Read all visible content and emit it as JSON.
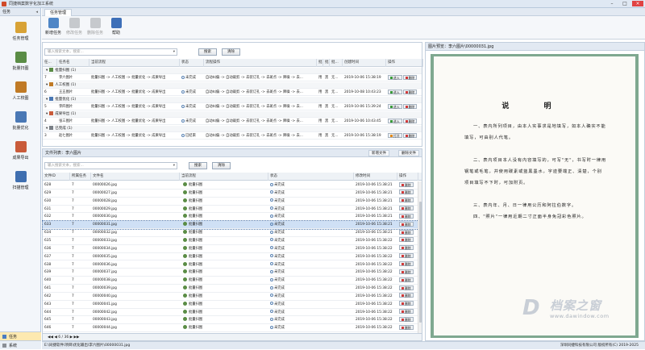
{
  "app": {
    "title": "同捷档案数字化加工系统"
  },
  "left": {
    "header": "任务",
    "items": [
      {
        "label": "任务管理",
        "color": "#d8a235"
      },
      {
        "label": "批量扫图",
        "color": "#5a8c45"
      },
      {
        "label": "人工校图",
        "color": "#c07a25"
      },
      {
        "label": "批量优化",
        "color": "#4a78b5"
      },
      {
        "label": "成果导出",
        "color": "#c95b3a"
      },
      {
        "label": "扫描管理",
        "color": "#3f6fb0"
      }
    ],
    "bottom": [
      {
        "label": "任务"
      },
      {
        "label": "系统"
      }
    ]
  },
  "tab": {
    "label": "任务管理"
  },
  "ribbon": {
    "buttons": [
      {
        "label": "新增任务",
        "enabled": true,
        "color": "#4f86c6"
      },
      {
        "label": "修改任务",
        "enabled": false
      },
      {
        "label": "删除任务",
        "enabled": false
      },
      {
        "label": "帮助",
        "enabled": true,
        "color": "#3d6fb8"
      }
    ]
  },
  "tasks": {
    "search_placeholder": "输入搜索文本，搜索...",
    "search_btn": "搜索",
    "clear_btn": "清除",
    "columns": [
      "任...",
      "任务名",
      "当前流程",
      "状态",
      "流程操作",
      "批",
      "批",
      "批...",
      "创建时间",
      "操作"
    ],
    "groups": [
      {
        "title": "批量扫图 (1)",
        "id": "7",
        "name": "李六图片",
        "flow": "批量扫图 -> 人工校图 -> 批量优化 -> 成果导出",
        "status": "未完成",
        "op": "自动纠偏 -> 自动裁剪 -> 去装订孔 -> 去斑点 -> 降噪 -> 去...",
        "b1": "用",
        "b2": "黑",
        "b3": "无...",
        "time": "2019-10-06 15:38:19",
        "a1": "进入",
        "a2": "删除"
      },
      {
        "title": "人工校图 (1)",
        "id": "6",
        "name": "王五图片",
        "flow": "批量扫图 -> 人工校图 -> 批量优化 -> 成果导出",
        "status": "未完成",
        "op": "自动纠偏 -> 自动裁剪 -> 去装订孔 -> 去斑点 -> 降噪 -> 去...",
        "b1": "用",
        "b2": "黑",
        "b3": "无...",
        "time": "2019-10-08 10:43:23",
        "a1": "进入",
        "a2": "删除"
      },
      {
        "title": "批量优化 (1)",
        "id": "5",
        "name": "李四图片",
        "flow": "批量扫图 -> 人工校图 -> 批量优化 -> 成果导出",
        "status": "未完成",
        "op": "自动纠偏 -> 自动裁剪 -> 去装订孔 -> 去斑点 -> 降噪 -> 去...",
        "b1": "用",
        "b2": "黑",
        "b3": "无...",
        "time": "2019-10-06 15:39:24",
        "a1": "进入",
        "a2": "删除"
      },
      {
        "title": "成果导出 (1)",
        "id": "4",
        "name": "张三图片",
        "flow": "批量扫图 -> 人工校图 -> 批量优化 -> 成果导出",
        "status": "未完成",
        "op": "自动纠偏 -> 自动裁剪 -> 去装订孔 -> 去斑点 -> 降噪 -> 去...",
        "b1": "用",
        "b2": "黑",
        "b3": "无...",
        "time": "2019-10-06 10:43:45",
        "a1": "进入",
        "a2": "删除"
      },
      {
        "title": "已完成 (1)",
        "id": "3",
        "name": "赵七图片",
        "flow": "批量扫图 -> 人工校图 -> 批量优化 -> 成果导出",
        "status": "已结束",
        "op": "自动纠偏 -> 自动裁剪 -> 去装订孔 -> 去斑点 -> 降噪 -> 去...",
        "b1": "用",
        "b2": "黑",
        "b3": "无...",
        "time": "2019-10-06 15:38:19",
        "a1": "打开",
        "a2": "删除"
      }
    ]
  },
  "files": {
    "header": "文件列表：李六图片",
    "btn_scan": "新增文件",
    "btn_delete": "删除文件",
    "search_placeholder": "输入搜索文本，搜索...",
    "search_btn": "搜索",
    "clear_btn": "清除",
    "columns": [
      "文件ID",
      "所属任务",
      "文件名",
      "当前流程",
      "状态",
      "修改时间",
      "操作"
    ],
    "rows": [
      {
        "id": "628",
        "task": "7",
        "name": "00000026.jpg",
        "flow": "批量扫图",
        "status": "未完成",
        "time": "2019-10-06 15:38:21",
        "op": "删除"
      },
      {
        "id": "629",
        "task": "7",
        "name": "00000027.jpg",
        "flow": "批量扫图",
        "status": "未完成",
        "time": "2019-10-06 15:38:21",
        "op": "删除"
      },
      {
        "id": "630",
        "task": "7",
        "name": "00000028.jpg",
        "flow": "批量扫图",
        "status": "未完成",
        "time": "2019-10-06 15:38:21",
        "op": "删除"
      },
      {
        "id": "631",
        "task": "7",
        "name": "00000029.jpg",
        "flow": "批量扫图",
        "status": "未完成",
        "time": "2019-10-06 15:38:21",
        "op": "删除"
      },
      {
        "id": "632",
        "task": "7",
        "name": "00000030.jpg",
        "flow": "批量扫图",
        "status": "未完成",
        "time": "2019-10-06 15:38:21",
        "op": "删除"
      },
      {
        "id": "633",
        "task": "7",
        "name": "00000031.jpg",
        "flow": "批量扫图",
        "status": "未完成",
        "time": "2019-10-06 15:38:21",
        "op": "删除"
      },
      {
        "id": "634",
        "task": "7",
        "name": "00000032.jpg",
        "flow": "批量扫图",
        "status": "未完成",
        "time": "2019-10-06 15:38:21",
        "op": "删除"
      },
      {
        "id": "635",
        "task": "7",
        "name": "00000033.jpg",
        "flow": "批量扫图",
        "status": "未完成",
        "time": "2019-10-06 15:38:22",
        "op": "删除"
      },
      {
        "id": "636",
        "task": "7",
        "name": "00000034.jpg",
        "flow": "批量扫图",
        "status": "未完成",
        "time": "2019-10-06 15:38:22",
        "op": "删除"
      },
      {
        "id": "637",
        "task": "7",
        "name": "00000035.jpg",
        "flow": "批量扫图",
        "status": "未完成",
        "time": "2019-10-06 15:38:22",
        "op": "删除"
      },
      {
        "id": "638",
        "task": "7",
        "name": "00000036.jpg",
        "flow": "批量扫图",
        "status": "未完成",
        "time": "2019-10-06 15:38:22",
        "op": "删除"
      },
      {
        "id": "639",
        "task": "7",
        "name": "00000037.jpg",
        "flow": "批量扫图",
        "status": "未完成",
        "time": "2019-10-06 15:38:22",
        "op": "删除"
      },
      {
        "id": "640",
        "task": "7",
        "name": "00000038.jpg",
        "flow": "批量扫图",
        "status": "未完成",
        "time": "2019-10-06 15:38:22",
        "op": "删除"
      },
      {
        "id": "641",
        "task": "7",
        "name": "00000039.jpg",
        "flow": "批量扫图",
        "status": "未完成",
        "time": "2019-10-06 15:38:22",
        "op": "删除"
      },
      {
        "id": "642",
        "task": "7",
        "name": "00000040.jpg",
        "flow": "批量扫图",
        "status": "未完成",
        "time": "2019-10-06 15:38:22",
        "op": "删除"
      },
      {
        "id": "643",
        "task": "7",
        "name": "00000041.jpg",
        "flow": "批量扫图",
        "status": "未完成",
        "time": "2019-10-06 15:38:22",
        "op": "删除"
      },
      {
        "id": "644",
        "task": "7",
        "name": "00000042.jpg",
        "flow": "批量扫图",
        "status": "未完成",
        "time": "2019-10-06 15:38:22",
        "op": "删除"
      },
      {
        "id": "645",
        "task": "7",
        "name": "00000043.jpg",
        "flow": "批量扫图",
        "status": "未完成",
        "time": "2019-10-06 15:38:22",
        "op": "删除"
      },
      {
        "id": "646",
        "task": "7",
        "name": "00000044.jpg",
        "flow": "批量扫图",
        "status": "未完成",
        "time": "2019-10-06 15:38:22",
        "op": "删除"
      }
    ],
    "pager": "◀◀ ◀ 6 / 36 ▶ ▶▶",
    "selected_index": 5
  },
  "preview": {
    "header": "图片预览：李六图片\\00000031.jpg",
    "doc_title": "说 明",
    "paragraphs": [
      "一、表内所列项目，由本人实事求是地填写，如本人确实不能填写，可由别人代笔。",
      "二、表内项目本人没有内容填写的，可写\"无\"，书写时一律用钢笔或毛笔，并使用碳素或蓝黑墨水，字迹要端正、清楚，个别项目填写不下时，可加附页。",
      "三、表内年、月、日一律用公历和阿拉伯数字。",
      "四、\"照片\"一律用近期二寸正面半身免冠彩色照片。"
    ],
    "watermark_big": "档案之窗",
    "watermark_url": "www.dawindow.com"
  },
  "status": {
    "path": "E:\\同捷软件\\项目\\优化输出\\李六图片\\00000031.jpg",
    "copyright": "深圳同捷科技有限公司 版权所有(C) 2019-2025"
  }
}
